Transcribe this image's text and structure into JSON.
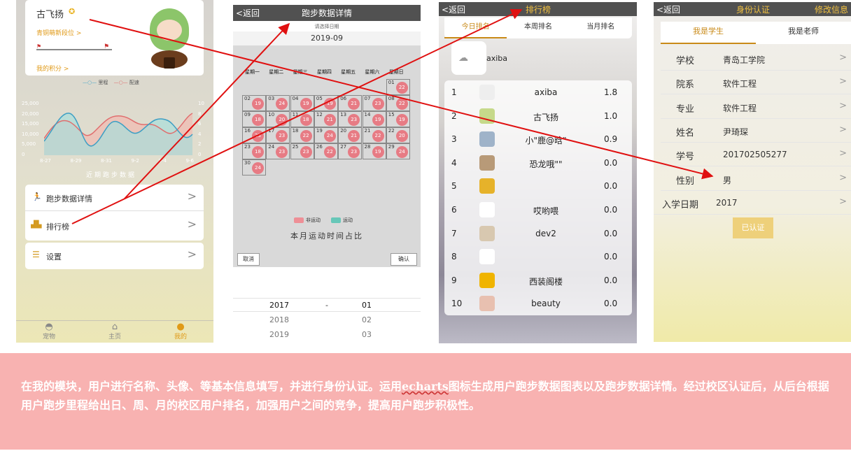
{
  "p1": {
    "user_name": "古飞扬",
    "level_link": "青铜萌新段位 >",
    "points_link": "我的积分 >",
    "legend": [
      "里程",
      "配速"
    ],
    "y_ticks_left": [
      "25,000",
      "20,000",
      "15,000",
      "10,000",
      "5,000",
      "0"
    ],
    "y_ticks_right": [
      "10",
      "8",
      "6",
      "4",
      "2",
      "0"
    ],
    "x_ticks": [
      "8-27",
      "8-29",
      "8-31",
      "9-2",
      "9-4",
      "9-6"
    ],
    "chart_caption": "近期跑步数据",
    "menu": [
      {
        "label": "跑步数据详情"
      },
      {
        "label": "排行榜"
      },
      {
        "label": "设置"
      }
    ],
    "tabbar": [
      {
        "label": "宠物"
      },
      {
        "label": "主页"
      },
      {
        "label": "我的"
      }
    ]
  },
  "p2": {
    "nav_back": "<返回",
    "nav_title": "跑步数据详情",
    "date_prompt": "请选择日期",
    "date_value": "2019-09",
    "weekdays": [
      "星期一",
      "星期二",
      "星期三",
      "星期四",
      "星期五",
      "星期六",
      "星期日"
    ],
    "days": [
      "01",
      "02",
      "03",
      "04",
      "05",
      "06",
      "07",
      "08",
      "09",
      "10",
      "11",
      "12",
      "13",
      "14",
      "15",
      "16",
      "17",
      "18",
      "19",
      "20",
      "21",
      "22",
      "23",
      "24",
      "25",
      "26",
      "27",
      "28",
      "29",
      "30"
    ],
    "pie_values": [
      "22",
      "19",
      "24",
      "19",
      "19",
      "21",
      "23",
      "22",
      "18",
      "20",
      "18",
      "21",
      "23",
      "19",
      "19",
      "23",
      "23",
      "22",
      "24",
      "21",
      "22",
      "20",
      "18",
      "23",
      "23",
      "22",
      "23",
      "19",
      "24",
      "24"
    ],
    "legend_not": "非运动",
    "legend_yes": "运动",
    "caption": "本月运动时间占比",
    "cancel": "取消",
    "confirm": "确认",
    "picker": [
      {
        "year": "2017",
        "sep": "-",
        "month": "01"
      },
      {
        "year": "2018",
        "sep": "",
        "month": "02"
      },
      {
        "year": "2019",
        "sep": "",
        "month": "03"
      }
    ]
  },
  "p3": {
    "nav_back": "<返回",
    "nav_title": "排行榜",
    "tabs": [
      "今日排名",
      "本周排名",
      "当月排名"
    ],
    "me_name": "axiba",
    "rows": [
      {
        "rank": "1",
        "name": "axiba",
        "score": "1.8"
      },
      {
        "rank": "2",
        "name": "古飞扬",
        "score": "1.0"
      },
      {
        "rank": "3",
        "name": "小\"鹿@晗\"",
        "score": "0.9"
      },
      {
        "rank": "4",
        "name": "恐龙哦\"\"",
        "score": "0.0"
      },
      {
        "rank": "5",
        "name": "",
        "score": "0.0"
      },
      {
        "rank": "6",
        "name": "哎哟喂",
        "score": "0.0"
      },
      {
        "rank": "7",
        "name": "dev2",
        "score": "0.0"
      },
      {
        "rank": "8",
        "name": "",
        "score": "0.0"
      },
      {
        "rank": "9",
        "name": "西装阁楼",
        "score": "0.0"
      },
      {
        "rank": "10",
        "name": "beauty",
        "score": "0.0"
      }
    ]
  },
  "p4": {
    "nav_back": "<返回",
    "nav_title": "身份认证",
    "nav_edit": "修改信息",
    "tabs": [
      "我是学生",
      "我是老师"
    ],
    "rows": [
      {
        "label": "学校",
        "value": "青岛工学院"
      },
      {
        "label": "院系",
        "value": "软件工程"
      },
      {
        "label": "专业",
        "value": "软件工程"
      },
      {
        "label": "姓名",
        "value": "尹琦琛"
      },
      {
        "label": "学号",
        "value": "201702505277"
      },
      {
        "label": "性别",
        "value": "男"
      },
      {
        "label": "入学日期",
        "value": "2017"
      }
    ],
    "verified": "已认证"
  },
  "banner": {
    "text_before": "在我的模块，用户进行名称、头像、等基本信息填写，并进行身份认证。运用",
    "text_link": "echarts",
    "text_after": "图标生成用户跑步数据图表以及跑步数据详情。经过校区认证后，从后台根据用户跑步里程给出日、周、月的校区用户排名，加强用户之间的竞争，提高用户跑步积极性。"
  },
  "colors": {
    "gold": "#c98a18",
    "pink": "#e77b84",
    "teal": "#67c7b8",
    "banner": "#f8b2b1",
    "arrow": "#e01010"
  }
}
